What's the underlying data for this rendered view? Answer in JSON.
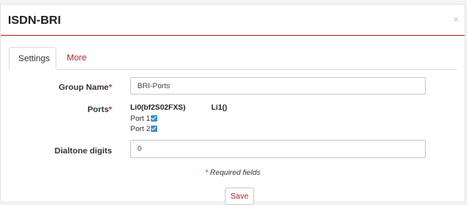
{
  "modal": {
    "title": "ISDN-BRI",
    "close_glyph": "×"
  },
  "tabs": [
    {
      "label": "Settings",
      "active": true
    },
    {
      "label": "More",
      "active": false
    }
  ],
  "form": {
    "group_name": {
      "label": "Group Name",
      "required_mark": "*",
      "value": "BRI-Ports"
    },
    "ports": {
      "label": "Ports",
      "required_mark": "*",
      "columns": [
        {
          "header": "Li0(bf2S02FXS)",
          "ports": [
            {
              "label": "Port 1",
              "checked": true
            },
            {
              "label": "Port 2",
              "checked": true
            }
          ]
        },
        {
          "header": "Li1()",
          "ports": []
        }
      ]
    },
    "dialtone": {
      "label": "Dialtone digits",
      "value": "0"
    }
  },
  "required_note": {
    "mark": "*",
    "text": " Required fields"
  },
  "save_label": "Save",
  "colors": {
    "accent": "#b3262a",
    "checkbox": "#3a8dde",
    "required": "#c9302c"
  },
  "icons": {
    "close": "close-icon",
    "checkbox": "checkbox-checked-icon"
  }
}
